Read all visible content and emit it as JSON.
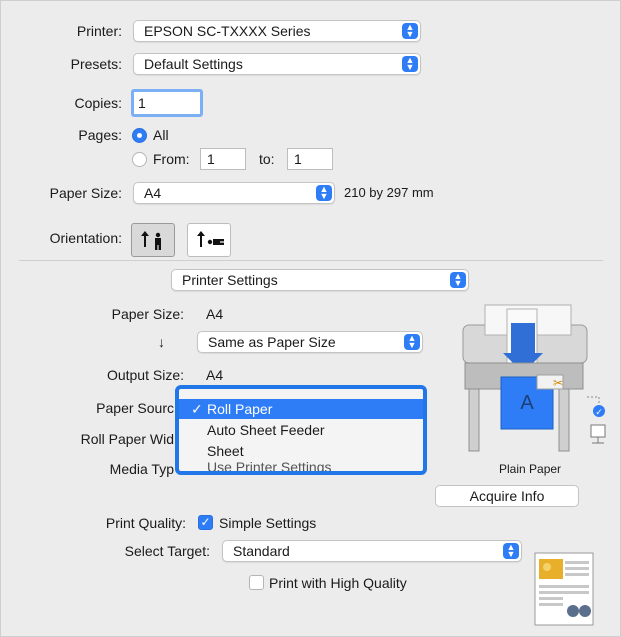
{
  "top": {
    "printer_label": "Printer:",
    "printer_value": "EPSON SC-TXXXX Series",
    "presets_label": "Presets:",
    "presets_value": "Default Settings",
    "copies_label": "Copies:",
    "copies_value": "1",
    "pages_label": "Pages:",
    "pages_all": "All",
    "pages_from": "From:",
    "pages_from_value": "1",
    "pages_to": "to:",
    "pages_to_value": "1",
    "paper_size_label": "Paper Size:",
    "paper_size_value": "A4",
    "paper_size_dims": "210 by 297 mm",
    "orientation_label": "Orientation:",
    "orientation_portrait_icon": "portrait-orientation-icon",
    "orientation_landscape_icon": "landscape-orientation-icon"
  },
  "section_menu": {
    "value": "Printer Settings"
  },
  "printer_settings": {
    "paper_size_label": "Paper Size:",
    "paper_size_value": "A4",
    "arrow": "↓",
    "scale_value": "Same as Paper Size",
    "output_size_label": "Output Size:",
    "output_size_value": "A4",
    "paper_source_label": "Paper Sourc",
    "roll_width_label": "Roll Paper Wid",
    "media_type_label": "Media Typ",
    "paper_type_caption": "Plain Paper",
    "acquire_info_label": "Acquire Info",
    "print_quality_label": "Print Quality:",
    "simple_settings_label": "Simple Settings",
    "simple_settings_checked": true,
    "select_target_label": "Select Target:",
    "select_target_value": "Standard",
    "high_quality_label": "Print with High Quality",
    "high_quality_checked": false
  },
  "dropdown": {
    "checkmark": "✓",
    "items": [
      "Roll Paper",
      "Auto Sheet Feeder",
      "Sheet"
    ],
    "selected_index": 0,
    "cut_text": "Use Printer Settings"
  },
  "colors": {
    "accent": "#2f7df6",
    "menu_border": "#2176e8"
  }
}
